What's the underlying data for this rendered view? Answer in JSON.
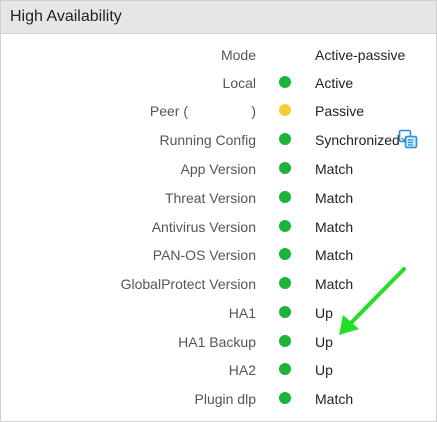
{
  "panel": {
    "title": "High Availability"
  },
  "rows": [
    {
      "label": "Mode",
      "value": "Active-passive",
      "status": null
    },
    {
      "label": "Local",
      "value": "Active",
      "status": "green"
    },
    {
      "label": "Peer (",
      "label_close": ")",
      "value": "Passive",
      "status": "yellow"
    },
    {
      "label": "Running Config",
      "value": "Synchronized",
      "status": "green",
      "icon": "sync-config-icon"
    },
    {
      "label": "App Version",
      "value": "Match",
      "status": "green"
    },
    {
      "label": "Threat Version",
      "value": "Match",
      "status": "green"
    },
    {
      "label": "Antivirus Version",
      "value": "Match",
      "status": "green"
    },
    {
      "label": "PAN-OS Version",
      "value": "Match",
      "status": "green"
    },
    {
      "label": "GlobalProtect Version",
      "value": "Match",
      "status": "green"
    },
    {
      "label": "HA1",
      "value": "Up",
      "status": "green"
    },
    {
      "label": "HA1 Backup",
      "value": "Up",
      "status": "green"
    },
    {
      "label": "HA2",
      "value": "Up",
      "status": "green"
    },
    {
      "label": "Plugin dlp",
      "value": "Match",
      "status": "green"
    }
  ],
  "colors": {
    "green": "#1db33a",
    "yellow": "#f2d034",
    "arrow": "#22e022",
    "sync_icon": "#2a8fd6"
  },
  "annotation": {
    "icon": "green-arrow-annotation"
  }
}
